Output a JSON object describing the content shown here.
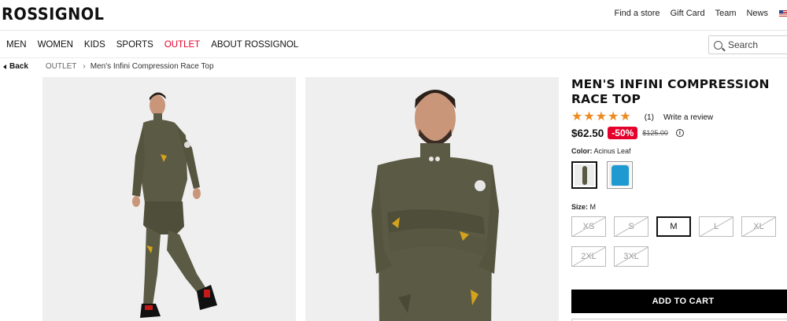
{
  "header": {
    "logo": "ROSSIGNOL",
    "utility_links": [
      "Find a store",
      "Gift Card",
      "Team",
      "News"
    ]
  },
  "nav": {
    "items": [
      "MEN",
      "WOMEN",
      "KIDS",
      "SPORTS",
      "OUTLET",
      "ABOUT ROSSIGNOL"
    ]
  },
  "search": {
    "placeholder": "Search"
  },
  "breadcrumb": {
    "back": "Back",
    "items": [
      "OUTLET",
      "Men's Infini Compression Race Top"
    ]
  },
  "product": {
    "title": "MEN'S INFINI COMPRESSION RACE TOP",
    "rating": 5,
    "review_count": "(1)",
    "write_review": "Write a review",
    "price": "$62.50",
    "discount": "-50%",
    "original_price": "$125.00",
    "color_label": "Color:",
    "color_value": "Acinus Leaf",
    "swatch_colors": [
      "#5a5a44",
      "#1e9ad1"
    ],
    "size_label": "Size:",
    "size_value": "M",
    "sizes": [
      {
        "label": "XS",
        "available": false
      },
      {
        "label": "S",
        "available": false
      },
      {
        "label": "M",
        "available": true,
        "selected": true
      },
      {
        "label": "L",
        "available": false
      },
      {
        "label": "XL",
        "available": false
      },
      {
        "label": "2XL",
        "available": false
      },
      {
        "label": "3XL",
        "available": false
      }
    ],
    "add_to_cart": "ADD TO CART",
    "suit_color": "#5b5a44"
  }
}
